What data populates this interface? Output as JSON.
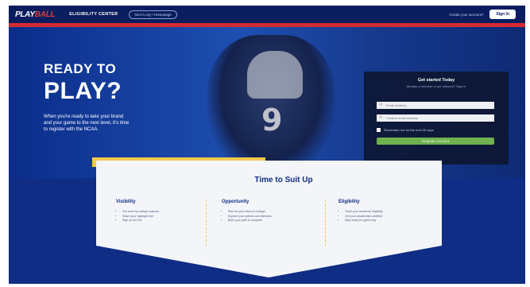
{
  "nav": {
    "logo_part1": "PLAY",
    "logo_part2": "BALL",
    "title": "ELIGIBILITY CENTER",
    "pill_label": "NCAA.org • Homepage",
    "question": "Create your account?",
    "signin_label": "Sign In"
  },
  "hero": {
    "title_line1": "READY TO",
    "title_line2": "PLAY?",
    "subtitle": "When you're ready to take your brand and your game to the next level, it's time to register with the NCAA.",
    "jersey_number": "9"
  },
  "registration": {
    "title": "Get started Today",
    "subtitle": "Already a member of our network? Sign in",
    "email_placeholder": "Email address",
    "confirm_placeholder": "Confirm email address",
    "checkbox_label": "Remember me for the next 30 days",
    "submit_label": "Register Account"
  },
  "panel": {
    "title": "Time to Suit Up",
    "columns": [
      {
        "heading": "Visibility",
        "items": [
          "Get seen by college coaches",
          "Share your highlight reel",
          "Sign up for free"
        ]
      },
      {
        "heading": "Opportunity",
        "items": [
          "Plan for your future in college",
          "Explore your options and divisions",
          "Build your path to compete"
        ]
      },
      {
        "heading": "Eligibility",
        "items": [
          "Track your academic eligibility",
          "Get your amateurism certified",
          "Stay ready for game day"
        ]
      }
    ]
  },
  "colors": {
    "navy": "#0a1d5e",
    "red": "#d42b32",
    "green": "#6fb24f",
    "yellow": "#f2c94c"
  }
}
